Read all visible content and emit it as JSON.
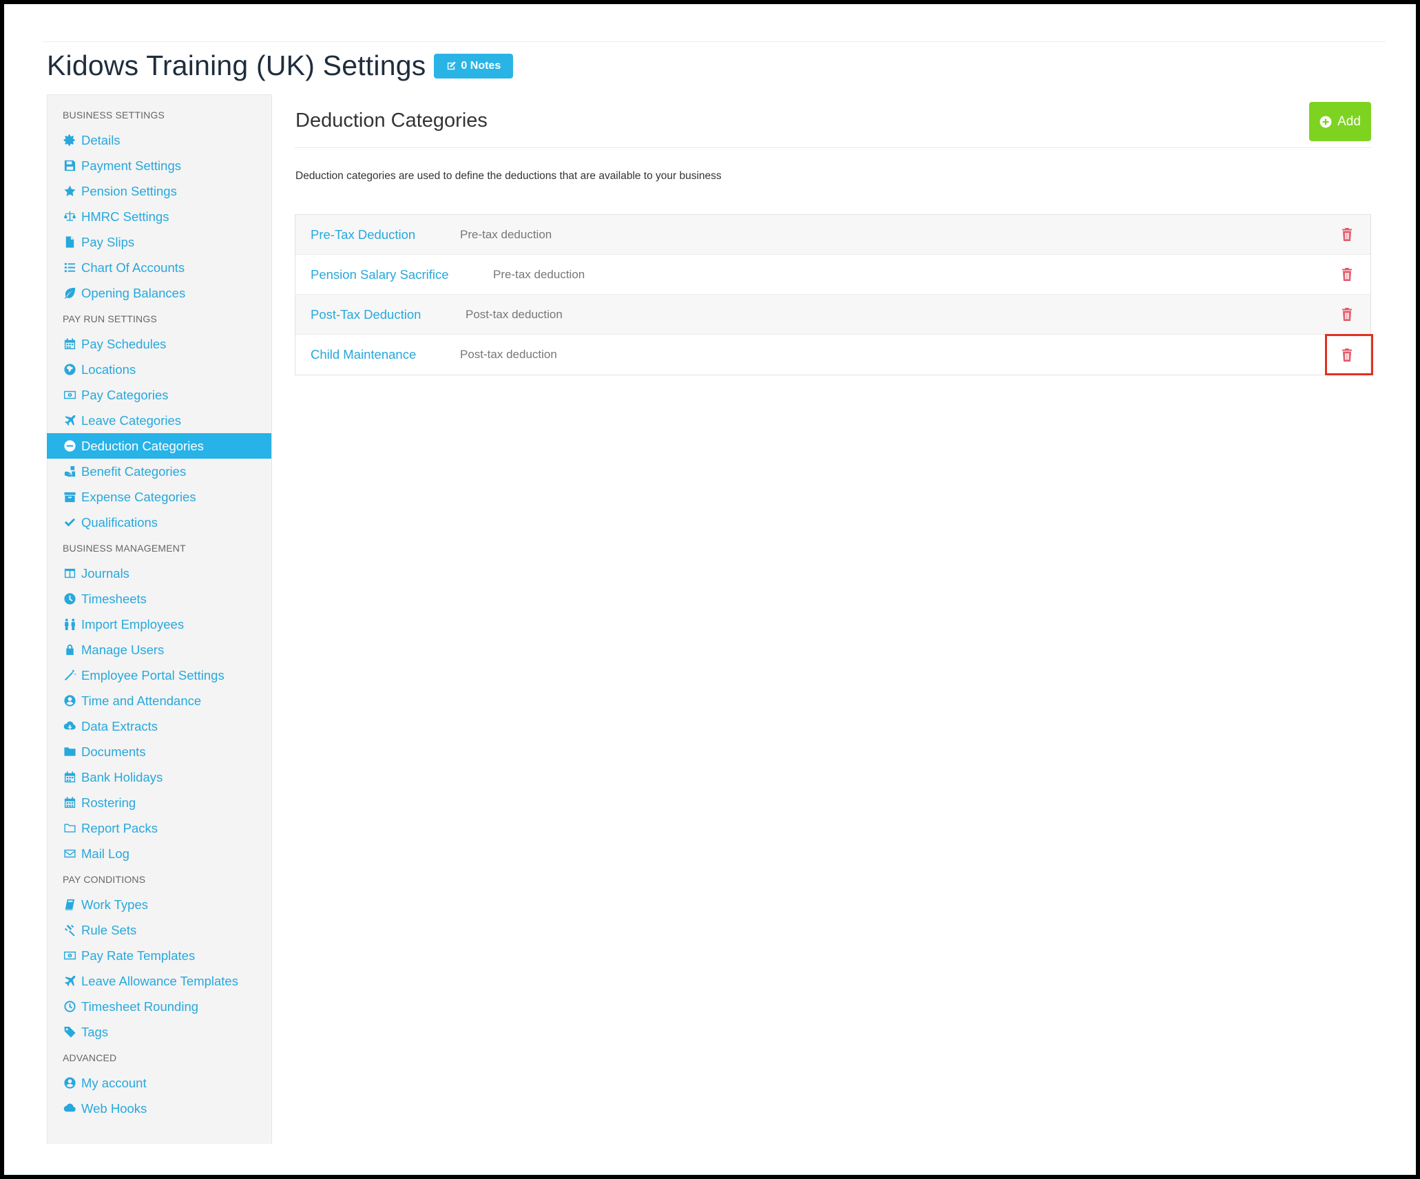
{
  "page": {
    "title": "Kidows Training (UK) Settings",
    "notes_label": "0 Notes"
  },
  "sidebar": {
    "sections": [
      {
        "heading": "BUSINESS SETTINGS",
        "items": [
          {
            "label": "Details",
            "icon": "gear-icon"
          },
          {
            "label": "Payment Settings",
            "icon": "floppy-icon"
          },
          {
            "label": "Pension Settings",
            "icon": "star-icon"
          },
          {
            "label": "HMRC Settings",
            "icon": "scales-icon"
          },
          {
            "label": "Pay Slips",
            "icon": "file-icon"
          },
          {
            "label": "Chart Of Accounts",
            "icon": "list-icon"
          },
          {
            "label": "Opening Balances",
            "icon": "leaf-icon"
          }
        ]
      },
      {
        "heading": "PAY RUN SETTINGS",
        "items": [
          {
            "label": "Pay Schedules",
            "icon": "calendar-icon"
          },
          {
            "label": "Locations",
            "icon": "globe-icon"
          },
          {
            "label": "Pay Categories",
            "icon": "money-icon"
          },
          {
            "label": "Leave Categories",
            "icon": "plane-icon"
          },
          {
            "label": "Deduction Categories",
            "icon": "minus-circle-icon",
            "active": true
          },
          {
            "label": "Benefit Categories",
            "icon": "hand-gift-icon"
          },
          {
            "label": "Expense Categories",
            "icon": "archive-icon"
          },
          {
            "label": "Qualifications",
            "icon": "check-icon"
          }
        ]
      },
      {
        "heading": "BUSINESS MANAGEMENT",
        "items": [
          {
            "label": "Journals",
            "icon": "columns-icon"
          },
          {
            "label": "Timesheets",
            "icon": "clock-icon"
          },
          {
            "label": "Import Employees",
            "icon": "people-icon"
          },
          {
            "label": "Manage Users",
            "icon": "lock-icon"
          },
          {
            "label": "Employee Portal Settings",
            "icon": "wand-icon"
          },
          {
            "label": "Time and Attendance",
            "icon": "user-circle-icon"
          },
          {
            "label": "Data Extracts",
            "icon": "cloud-download-icon"
          },
          {
            "label": "Documents",
            "icon": "folder-icon"
          },
          {
            "label": "Bank Holidays",
            "icon": "calendar-icon"
          },
          {
            "label": "Rostering",
            "icon": "calendar-grid-icon"
          },
          {
            "label": "Report Packs",
            "icon": "folder-outline-icon"
          },
          {
            "label": "Mail Log",
            "icon": "envelope-icon"
          }
        ]
      },
      {
        "heading": "PAY CONDITIONS",
        "items": [
          {
            "label": "Work Types",
            "icon": "book-icon"
          },
          {
            "label": "Rule Sets",
            "icon": "gavel-icon"
          },
          {
            "label": "Pay Rate Templates",
            "icon": "money-icon"
          },
          {
            "label": "Leave Allowance Templates",
            "icon": "plane-icon"
          },
          {
            "label": "Timesheet Rounding",
            "icon": "clock-outline-icon"
          },
          {
            "label": "Tags",
            "icon": "tag-icon"
          }
        ]
      },
      {
        "heading": "ADVANCED",
        "items": [
          {
            "label": "My account",
            "icon": "user-circle-icon"
          },
          {
            "label": "Web Hooks",
            "icon": "cloud-icon"
          }
        ]
      }
    ]
  },
  "main": {
    "title": "Deduction Categories",
    "add_label": "Add",
    "description": "Deduction categories are used to define the deductions that are available to your business",
    "categories": [
      {
        "name": "Pre-Tax Deduction",
        "type": "Pre-tax deduction"
      },
      {
        "name": "Pension Salary Sacrifice",
        "type": "Pre-tax deduction"
      },
      {
        "name": "Post-Tax Deduction",
        "type": "Post-tax deduction"
      },
      {
        "name": "Child Maintenance",
        "type": "Post-tax deduction",
        "highlighted": true
      }
    ]
  },
  "colors": {
    "link": "#27a8dc",
    "active_bg": "#27b2e8",
    "add_button": "#7ed321",
    "delete_icon": "#e05a6b",
    "highlight": "#e0311f"
  }
}
